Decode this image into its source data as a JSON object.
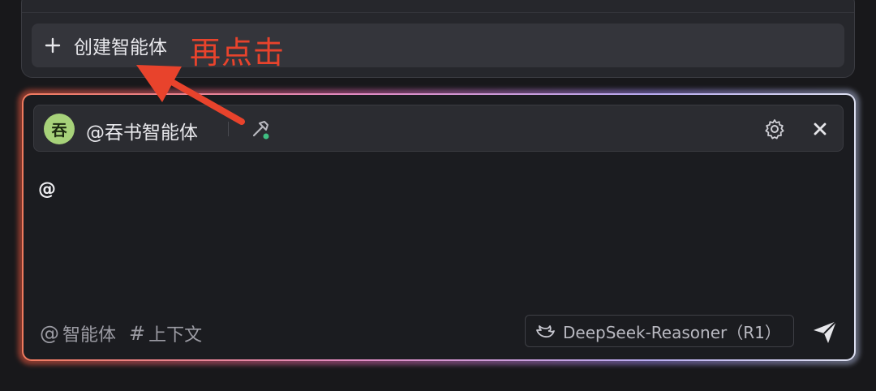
{
  "menu": {
    "create_label": "创建智能体"
  },
  "annotation": {
    "text": "再点击",
    "color": "#e8432c"
  },
  "agent": {
    "avatar_char": "吞",
    "name": "@吞书智能体"
  },
  "composer": {
    "input_value": "@",
    "mention_label": "智能体",
    "mention_symbol": "@",
    "context_label": "上下文",
    "context_symbol": "#",
    "model_label": "DeepSeek-Reasoner（R1）"
  },
  "icons": {
    "plus": "plus-icon",
    "hammer": "hammer-icon",
    "gear": "gear-icon",
    "close": "close-icon",
    "whale": "whale-icon",
    "send": "send-icon"
  }
}
